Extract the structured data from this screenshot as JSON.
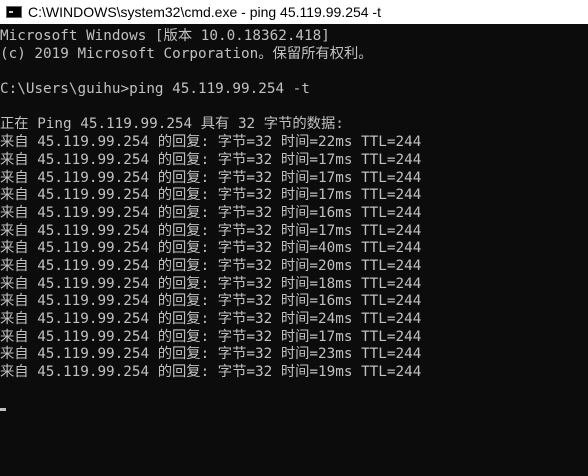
{
  "window": {
    "title": "C:\\WINDOWS\\system32\\cmd.exe - ping  45.119.99.254 -t",
    "icon": "console-icon"
  },
  "console": {
    "header_line1": "Microsoft Windows [版本 10.0.18362.418]",
    "header_line2": "(c) 2019 Microsoft Corporation。保留所有权利。",
    "prompt": "C:\\Users\\guihu>ping 45.119.99.254 -t",
    "ping_start": "正在 Ping 45.119.99.254 具有 32 字节的数据:",
    "replies": [
      "来自 45.119.99.254 的回复: 字节=32 时间=22ms TTL=244",
      "来自 45.119.99.254 的回复: 字节=32 时间=17ms TTL=244",
      "来自 45.119.99.254 的回复: 字节=32 时间=17ms TTL=244",
      "来自 45.119.99.254 的回复: 字节=32 时间=17ms TTL=244",
      "来自 45.119.99.254 的回复: 字节=32 时间=16ms TTL=244",
      "来自 45.119.99.254 的回复: 字节=32 时间=17ms TTL=244",
      "来自 45.119.99.254 的回复: 字节=32 时间=40ms TTL=244",
      "来自 45.119.99.254 的回复: 字节=32 时间=20ms TTL=244",
      "来自 45.119.99.254 的回复: 字节=32 时间=18ms TTL=244",
      "来自 45.119.99.254 的回复: 字节=32 时间=16ms TTL=244",
      "来自 45.119.99.254 的回复: 字节=32 时间=24ms TTL=244",
      "来自 45.119.99.254 的回复: 字节=32 时间=17ms TTL=244",
      "来自 45.119.99.254 的回复: 字节=32 时间=23ms TTL=244",
      "来自 45.119.99.254 的回复: 字节=32 时间=19ms TTL=244"
    ]
  },
  "colors": {
    "background": "#0c0c0c",
    "text": "#c0c0c0",
    "titlebar": "#ffffff"
  }
}
